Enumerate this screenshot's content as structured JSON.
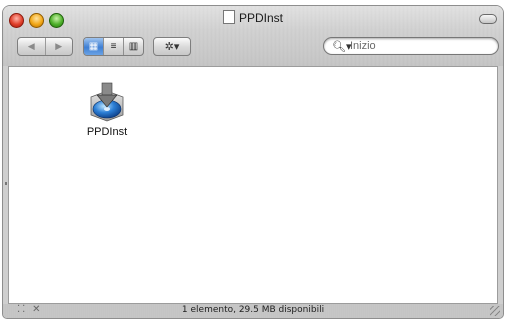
{
  "window": {
    "title": "PPDInst"
  },
  "toolbar": {
    "nav_back": "◀",
    "nav_forward": "▶",
    "view_icon": "▦",
    "view_list": "≡",
    "view_column": "▥",
    "action_label": "✲▾",
    "search_glyph": "🔍︎▾",
    "search_placeholder": "Inizio"
  },
  "files": [
    {
      "name": "PPDInst",
      "icon": "installer-package-icon"
    }
  ],
  "status": {
    "text": "1 elemento, 29.5 MB disponibili",
    "left_glyphs": "⁚⁚ ✕"
  },
  "colors": {
    "accent": "#3e7fd4"
  }
}
